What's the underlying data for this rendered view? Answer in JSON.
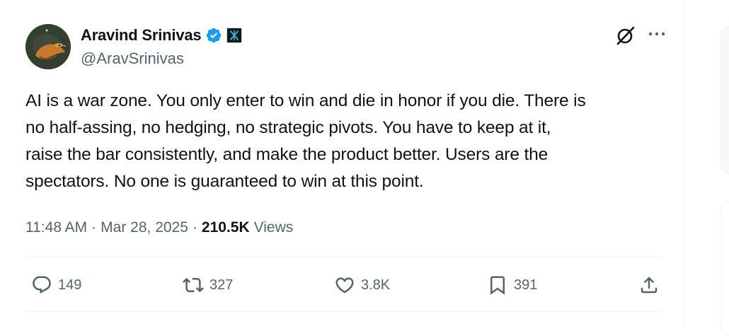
{
  "author": {
    "display_name": "Aravind Srinivas",
    "handle": "@AravSrinivas",
    "verified": true
  },
  "tweet": {
    "text": "AI is a war zone. You only enter to win and die in honor if you die. There is\nno half-assing, no hedging, no strategic pivots. You have to keep at it,\nraise the bar consistently, and make the product better. Users are the\nspectators. No one is guaranteed to win at this point."
  },
  "meta": {
    "time": "11:48 AM",
    "separator": "·",
    "date": "Mar 28, 2025",
    "views_count": "210.5K",
    "views_label": "Views"
  },
  "actions": {
    "replies": "149",
    "reposts": "327",
    "likes": "3.8K",
    "bookmarks": "391"
  },
  "icons": {
    "verified": "verified-badge-icon",
    "affiliate": "affiliate-badge-icon",
    "grok": "grok-icon",
    "more": "more-icon",
    "reply": "reply-icon",
    "repost": "repost-icon",
    "like": "heart-icon",
    "bookmark": "bookmark-icon",
    "share": "share-icon"
  },
  "colors": {
    "verified_blue": "#1d9bf0",
    "text_primary": "#0f1419",
    "text_secondary": "#536471",
    "divider": "#eff3f4"
  }
}
